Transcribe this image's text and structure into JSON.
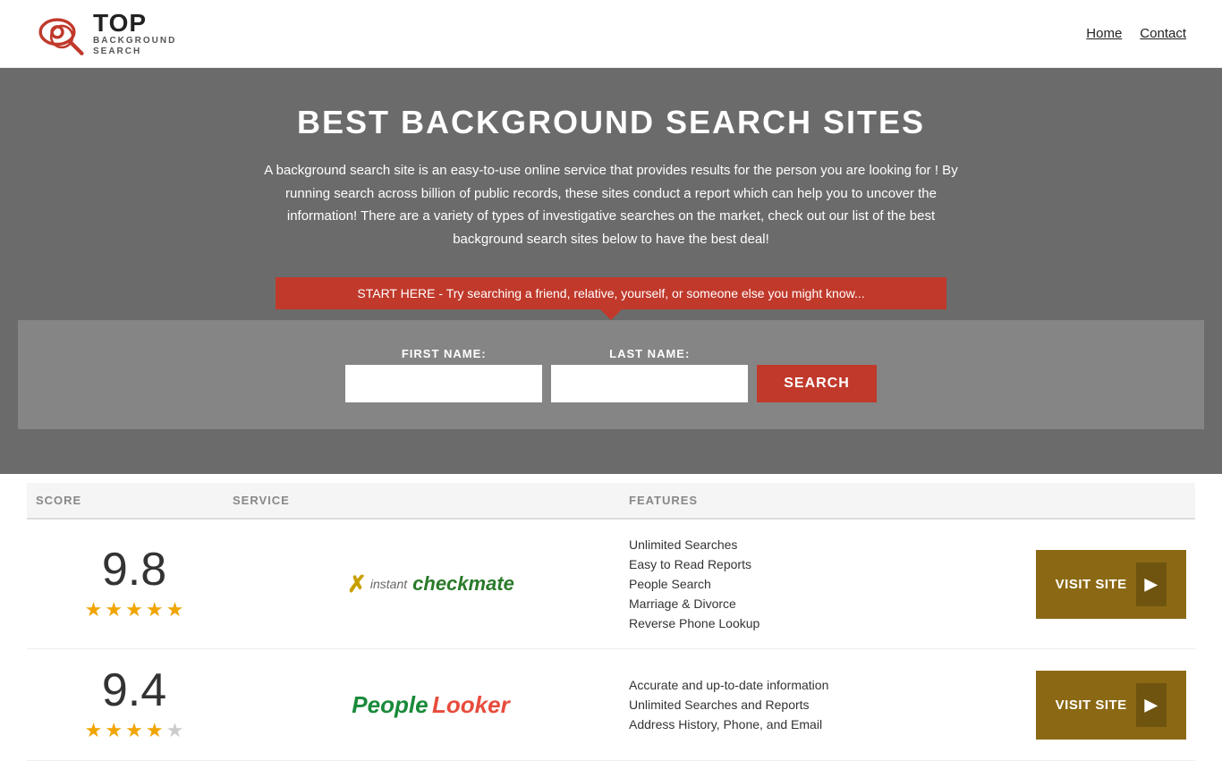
{
  "header": {
    "logo_top": "TOP",
    "logo_sub": "BACKGROUND\nSEARCH",
    "nav": [
      {
        "label": "Home",
        "href": "#"
      },
      {
        "label": "Contact",
        "href": "#"
      }
    ]
  },
  "hero": {
    "title": "BEST BACKGROUND SEARCH SITES",
    "description": "A background search site is an easy-to-use online service that provides results  for the person you are looking for ! By  running  search across billion of public records, these sites conduct  a report which can help you to uncover the information! There are a variety of types of investigative searches on the market, check out our  list of the best background search sites below to have the best deal!",
    "banner_text": "START HERE - Try searching a friend, relative, yourself, or someone else you might know...",
    "first_name_label": "FIRST NAME:",
    "last_name_label": "LAST NAME:",
    "search_button": "SEARCH"
  },
  "table": {
    "headers": {
      "score": "SCORE",
      "service": "SERVICE",
      "features": "FEATURES",
      "action": ""
    },
    "rows": [
      {
        "score": "9.8",
        "stars": 4.5,
        "service_name": "InstantCheckmate",
        "features": [
          "Unlimited Searches",
          "Easy to Read Reports",
          "People Search",
          "Marriage & Divorce",
          "Reverse Phone Lookup"
        ],
        "visit_label": "VISIT SITE"
      },
      {
        "score": "9.4",
        "stars": 4.5,
        "service_name": "PeopleLooker",
        "features": [
          "Accurate and up-to-date information",
          "Unlimited Searches and Reports",
          "Address History, Phone, and Email"
        ],
        "visit_label": "VISIT SITE"
      }
    ]
  }
}
